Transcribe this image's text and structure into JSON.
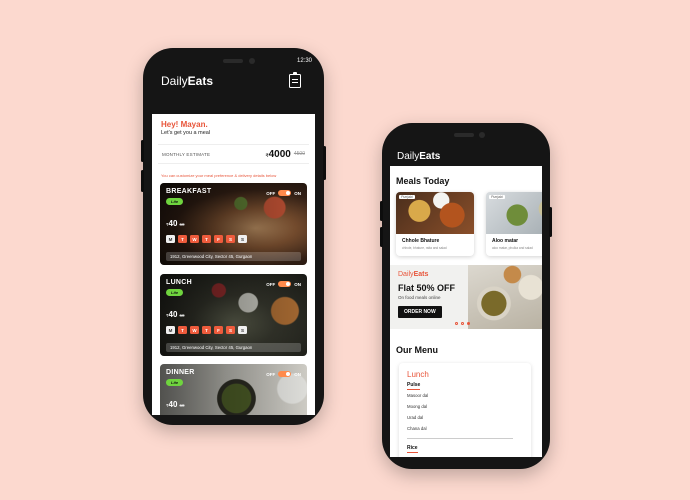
{
  "phone1": {
    "status_time": "12:30",
    "app": {
      "brand_light": "Daily",
      "brand_bold": "Eats"
    },
    "greeting": {
      "title": "Hey! Mayan.",
      "subtitle": "Let's get you a meal"
    },
    "estimate": {
      "label": "MONTHLY ESTIMATE",
      "currency": "₹",
      "value": "4000",
      "old_value": "4500"
    },
    "customize_note": "You can customize your meal preference & delivery details below",
    "toggle": {
      "off": "OFF",
      "on": "ON"
    },
    "meals": [
      {
        "title": "BREAKFAST",
        "tag": "Lite",
        "currency": "₹",
        "price": "40",
        "old_price": "60",
        "address": "1912, Greenwood City, Sector 45, Gurgaon"
      },
      {
        "title": "LUNCH",
        "tag": "Lite",
        "currency": "₹",
        "price": "40",
        "old_price": "60",
        "address": "1912, Greenwood City, Sector 45, Gurgaon"
      },
      {
        "title": "DINNER",
        "tag": "Lite",
        "currency": "₹",
        "price": "40",
        "old_price": "60"
      }
    ],
    "days": [
      "M",
      "T",
      "W",
      "T",
      "F",
      "S",
      "S"
    ]
  },
  "phone2": {
    "app": {
      "brand_light": "Daily",
      "brand_bold": "Eats"
    },
    "meals_today_title": "Meals Today",
    "meals_today": [
      {
        "badge": "Punjabi",
        "name": "Chhole Bhature",
        "desc": "chhole, bhature, raita and salad"
      },
      {
        "badge": "Punjabi",
        "name": "Aloo matar",
        "desc": "aloo matar, phulka and salad"
      }
    ],
    "promo": {
      "brand_light": "Daily",
      "brand_bold": "Eats",
      "headline": "Flat 50% OFF",
      "subline": "On food meals online",
      "button": "ORDER NOW"
    },
    "our_menu_title": "Our Menu",
    "menu": {
      "meal": "Lunch",
      "categories": [
        {
          "name": "Pulse",
          "items": [
            "Masoor dal",
            "Moong dal",
            "Urad dal",
            "Chana dal"
          ]
        },
        {
          "name": "Rice",
          "items": []
        }
      ]
    }
  },
  "colors": {
    "background": "#fcd9cf",
    "accent": "#e8553a",
    "tag_green": "#6fd43e",
    "toggle_orange": "#ff8a4c"
  }
}
